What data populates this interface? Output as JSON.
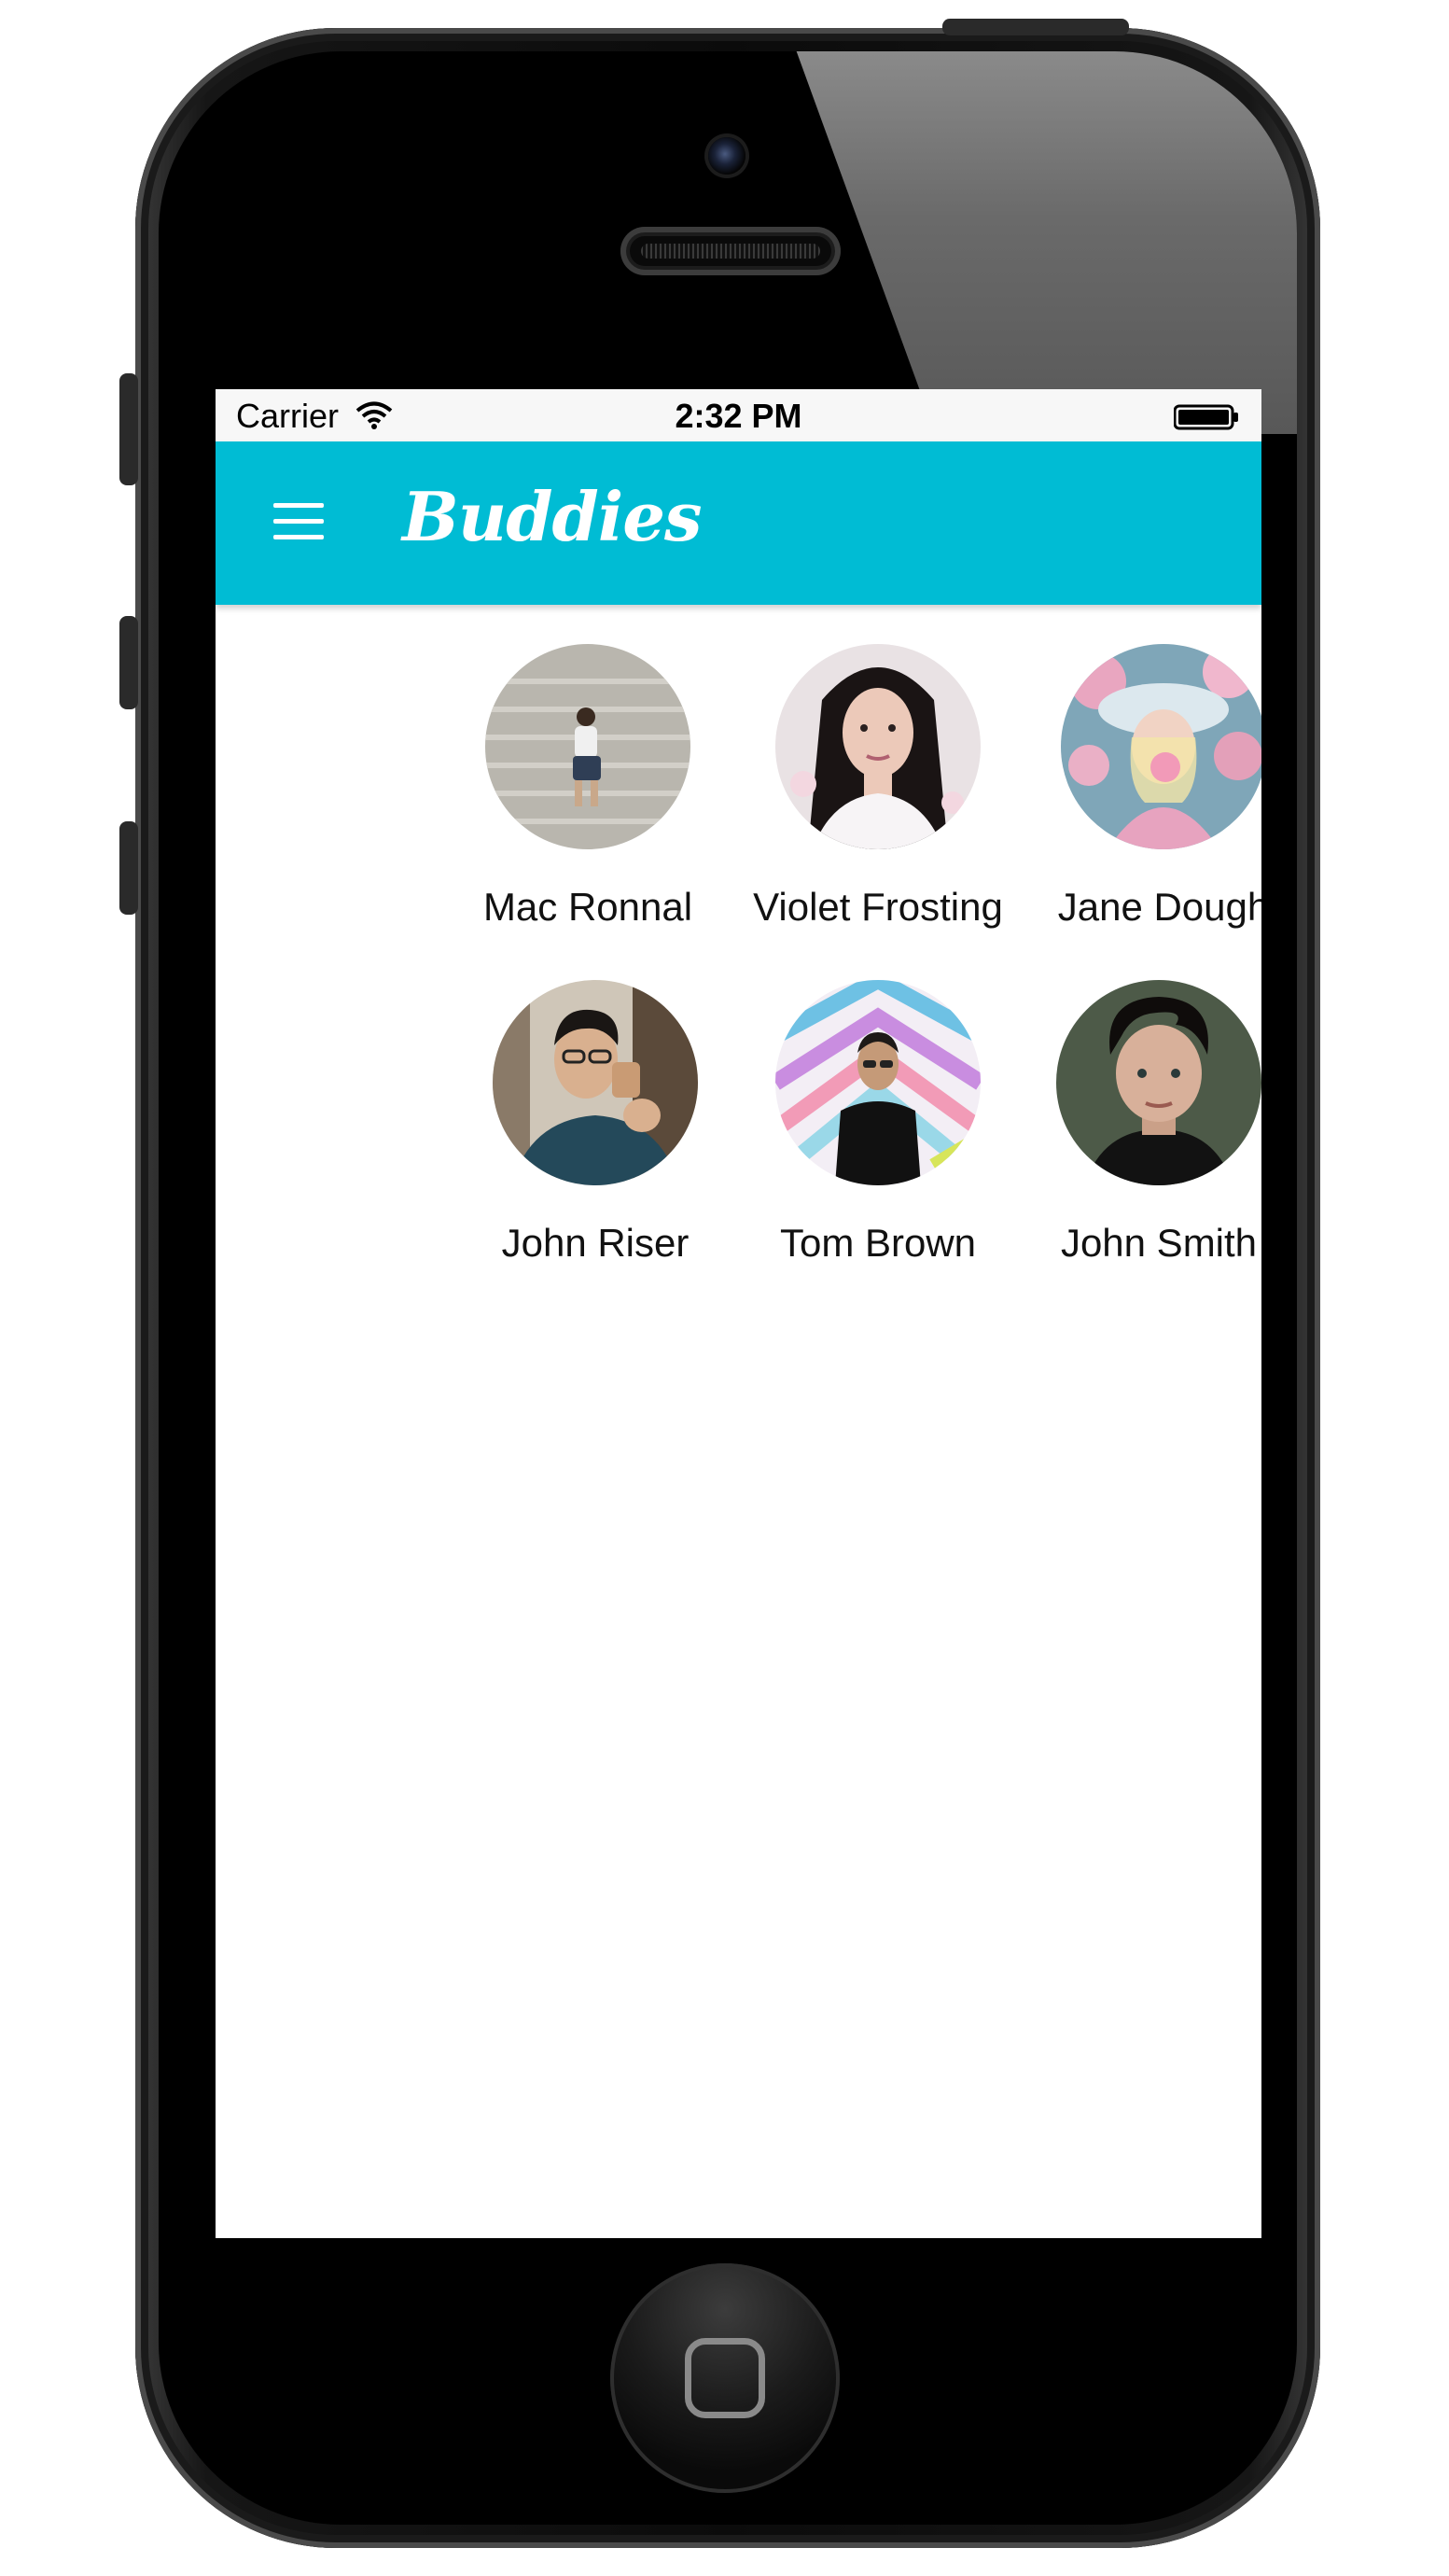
{
  "status_bar": {
    "carrier": "Carrier",
    "time": "2:32 PM",
    "wifi_icon": "wifi-icon",
    "battery_icon": "battery-icon"
  },
  "app_bar": {
    "title": "Buddies",
    "menu_icon": "hamburger-menu-icon",
    "color": "#00bcd4"
  },
  "buddies": [
    {
      "name": "Mac Ronnal",
      "avatar": "photo-person-sitting-on-steps"
    },
    {
      "name": "Violet Frosting",
      "avatar": "photo-woman-dark-hair"
    },
    {
      "name": "Jane Dough",
      "avatar": "photo-woman-blowing-bubblegum"
    },
    {
      "name": "John Riser",
      "avatar": "photo-man-drinking-coffee"
    },
    {
      "name": "Tom Brown",
      "avatar": "photo-man-colorful-wall"
    },
    {
      "name": "John Smith",
      "avatar": "photo-man-curly-hair"
    }
  ]
}
